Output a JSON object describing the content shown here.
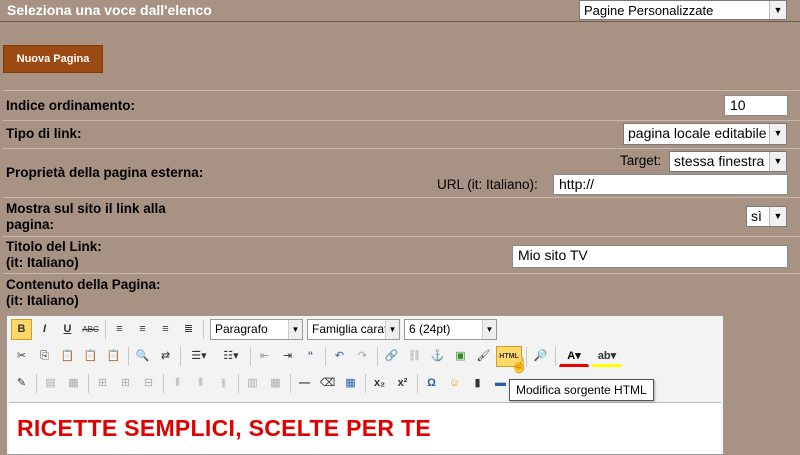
{
  "header": {
    "title": "Seleziona una voce dall'elenco",
    "page_type_select": "Pagine Personalizzate"
  },
  "new_page_button": "Nuova Pagina",
  "form": {
    "order_index": {
      "label": "Indice ordinamento:",
      "value": "10"
    },
    "link_type": {
      "label": "Tipo di link:",
      "value": "pagina locale editabile"
    },
    "external_page": {
      "label": "Proprietà della pagina esterna:",
      "target_label": "Target:",
      "target_value": "stessa finestra",
      "url_label": "URL (it: Italiano):",
      "url_value": "http://"
    },
    "show_link": {
      "label_line1": "Mostra sul sito il link alla",
      "label_line2": "pagina:",
      "value": "sì"
    },
    "link_title": {
      "label_line1": "Titolo del Link:",
      "label_line2": "(it: Italiano)",
      "value": "Mio sito TV"
    },
    "page_content": {
      "label_line1": "Contenuto della Pagina:",
      "label_line2": "(it: Italiano)"
    }
  },
  "editor": {
    "format_select": "Paragrafo",
    "font_family_select": "Famiglia caratt",
    "font_size_select": "6 (24pt)",
    "content_heading": "RICETTE SEMPLICI, SCELTE PER TE",
    "tooltip": "Modifica sorgente HTML",
    "html_button_label": "HTML"
  },
  "colors": {
    "background": "#a89284",
    "button": "#9b4a12",
    "heading_red": "#e00000"
  }
}
